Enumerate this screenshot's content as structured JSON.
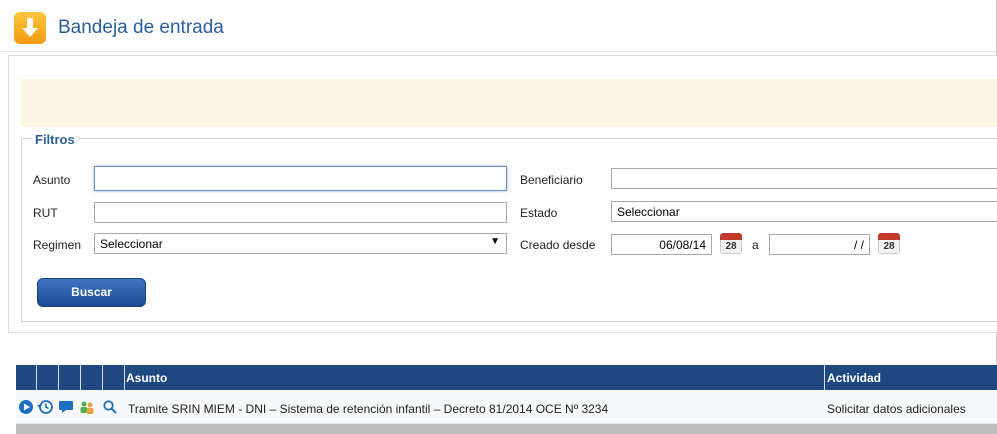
{
  "header": {
    "title": "Bandeja de entrada",
    "icon": "download-arrow-icon"
  },
  "filters": {
    "legend": "Filtros",
    "asunto": {
      "label": "Asunto",
      "value": ""
    },
    "beneficiario": {
      "label": "Beneficiario",
      "value": ""
    },
    "rut": {
      "label": "RUT",
      "value": ""
    },
    "estado": {
      "label": "Estado",
      "selected": "Seleccionar"
    },
    "regimen": {
      "label": "Regimen",
      "selected": "Seleccionar"
    },
    "creado_desde": {
      "label": "Creado desde",
      "from_value": "06/08/14",
      "separator": "a",
      "to_value": "/ /",
      "calendar_day": "28"
    },
    "search_button": "Buscar"
  },
  "grid": {
    "columns": [
      "Asunto",
      "Actividad"
    ],
    "rows": [
      {
        "icons": [
          "play-icon",
          "history-icon",
          "comment-icon",
          "users-icon",
          "search-icon"
        ],
        "asunto": "Tramite SRIN MIEM - DNI – Sistema de retención infantil – Decreto 81/2014 OCE Nº 3234",
        "actividad": "Solicitar datos adicionales"
      }
    ]
  },
  "colors": {
    "accent": "#1f4780",
    "title": "#2a5f9e",
    "notice_bg": "#fdf4e6"
  }
}
